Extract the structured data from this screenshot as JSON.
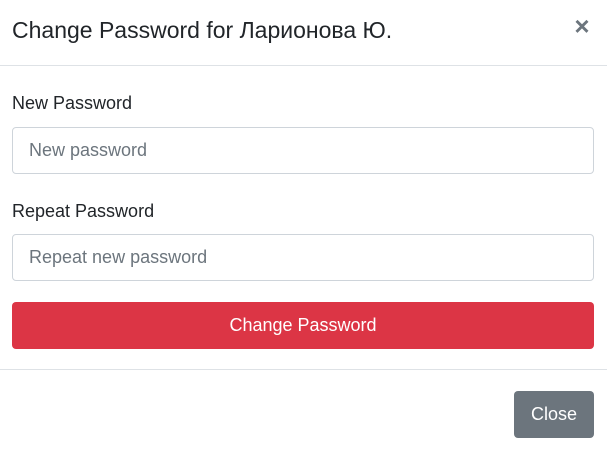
{
  "dialog": {
    "title": "Change Password for Ларионова Ю.",
    "close_icon": "close-icon"
  },
  "form": {
    "new_password": {
      "label": "New Password",
      "placeholder": "New password",
      "value": ""
    },
    "repeat_password": {
      "label": "Repeat Password",
      "placeholder": "Repeat new password",
      "value": ""
    },
    "submit_label": "Change Password"
  },
  "footer": {
    "close_label": "Close"
  },
  "colors": {
    "danger": "#dc3545",
    "secondary": "#6c757d",
    "border": "#dee2e6"
  }
}
